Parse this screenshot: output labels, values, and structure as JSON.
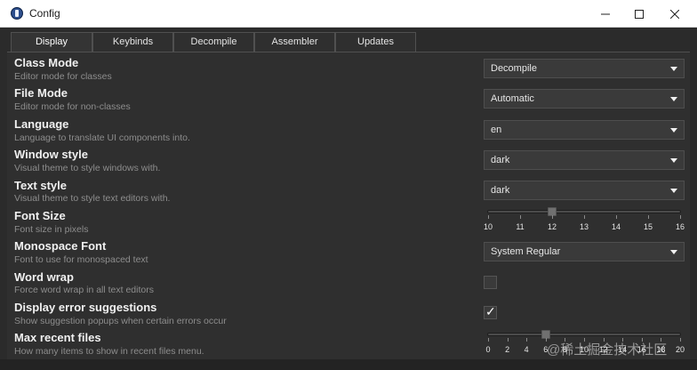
{
  "window": {
    "title": "Config",
    "minimize": "minimize",
    "maximize": "maximize",
    "close": "close"
  },
  "tabs": [
    {
      "label": "Display",
      "active": true
    },
    {
      "label": "Keybinds",
      "active": false
    },
    {
      "label": "Decompile",
      "active": false
    },
    {
      "label": "Assembler",
      "active": false
    },
    {
      "label": "Updates",
      "active": false
    }
  ],
  "settings": {
    "class_mode": {
      "title": "Class Mode",
      "desc": "Editor mode for classes",
      "value": "Decompile"
    },
    "file_mode": {
      "title": "File Mode",
      "desc": "Editor mode for non-classes",
      "value": "Automatic"
    },
    "language": {
      "title": "Language",
      "desc": "Language to translate UI components into.",
      "value": "en"
    },
    "window_style": {
      "title": "Window style",
      "desc": "Visual theme to style windows with.",
      "value": "dark"
    },
    "text_style": {
      "title": "Text style",
      "desc": "Visual theme to style text editors with.",
      "value": "dark"
    },
    "font_size": {
      "title": "Font Size",
      "desc": "Font size in pixels",
      "value": 12,
      "min": 10,
      "max": 16,
      "tick_labels": [
        "10",
        "11",
        "12",
        "13",
        "14",
        "15",
        "16"
      ]
    },
    "mono_font": {
      "title": "Monospace Font",
      "desc": "Font to use for monospaced text",
      "value": "System Regular"
    },
    "word_wrap": {
      "title": "Word wrap",
      "desc": "Force word wrap in all text editors",
      "checked": false
    },
    "error_suggestions": {
      "title": "Display error suggestions",
      "desc": "Show suggestion popups when certain errors occur",
      "checked": true,
      "check_glyph": "✓"
    },
    "max_recent": {
      "title": "Max recent files",
      "desc": "How many items to show in recent files menu.",
      "value": 6,
      "min": 0,
      "max": 20,
      "tick_labels": [
        "0",
        "2",
        "4",
        "6",
        "8",
        "10",
        "12",
        "14",
        "16",
        "18",
        "20"
      ]
    }
  },
  "watermark": "@稀土掘金技术社区"
}
